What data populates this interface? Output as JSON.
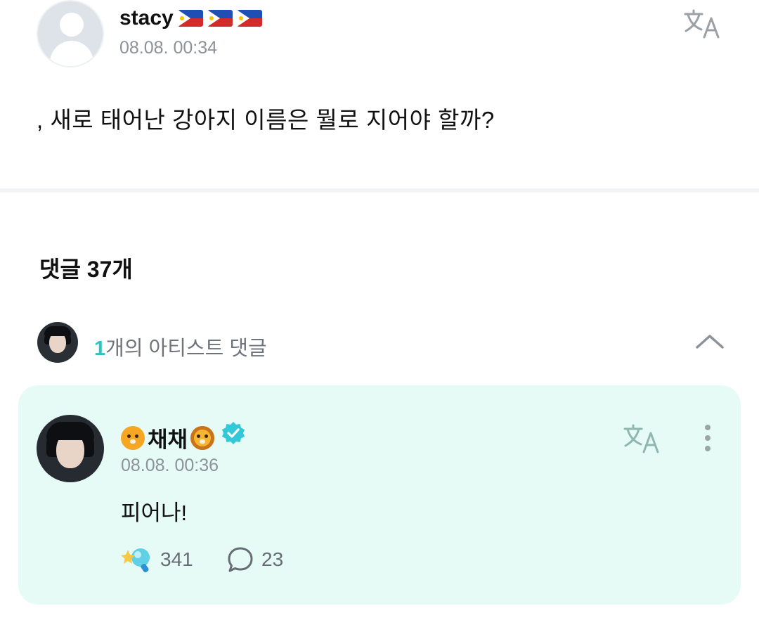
{
  "post": {
    "author": "stacy",
    "author_flags": [
      "philippines-flag",
      "philippines-flag",
      "philippines-flag"
    ],
    "date": "08.08. 00:34",
    "body": ", 새로 태어난 강아지 이름은 뭘로 지어야 할까?",
    "translate_icon": "translate-icon"
  },
  "comments": {
    "header": "댓글 37개",
    "artist_toggle": {
      "count": "1",
      "label": "개의 아티스트 댓글",
      "chevron_icon": "chevron-up-icon"
    },
    "artist_comment": {
      "author_prefix_emoji": "tiger-face-emoji",
      "author": "채채",
      "author_suffix_emoji": "lion-face-emoji",
      "verified_icon": "verified-badge-icon",
      "date": "08.08. 00:36",
      "text": "피어나!",
      "likes": "341",
      "replies": "23"
    }
  },
  "colors": {
    "accent": "#2bc4c4",
    "card_bg": "#e7fbf6",
    "muted_text": "#8c929a",
    "verified": "#33c8d8"
  }
}
